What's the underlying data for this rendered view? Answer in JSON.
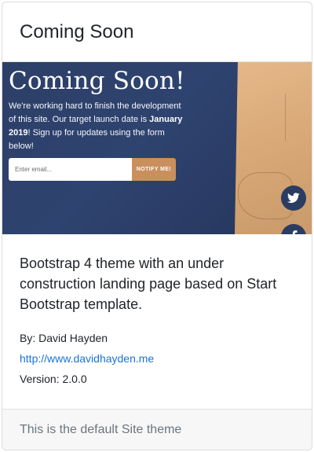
{
  "card": {
    "header_title": "Coming Soon",
    "preview": {
      "heading": "Coming Soon!",
      "desc_part1": "We're working hard to finish the development of this site. Our target launch date is ",
      "desc_bold": "January 2019",
      "desc_part2": "! Sign up for updates using the form below!",
      "email_placeholder": "Enter email...",
      "notify_label": "NOTIFY ME!",
      "social_icons": [
        "twitter-icon",
        "facebook-icon",
        "instagram-icon"
      ],
      "colors": {
        "background": "#2c3f67",
        "button": "#c9905e",
        "social": "#2b3c63"
      }
    },
    "description": "Bootstrap 4 theme with an under construction landing page based on Start Bootstrap template.",
    "by": "By: David Hayden",
    "link": "http://www.davidhayden.me",
    "version": "Version: 2.0.0",
    "footer": "This is the default Site theme"
  }
}
